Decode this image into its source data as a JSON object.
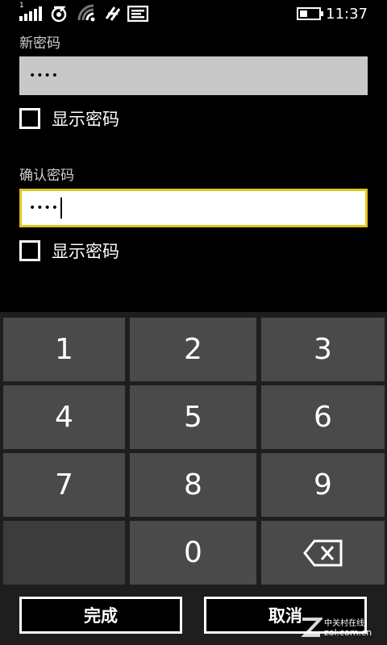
{
  "status_bar": {
    "time": "11:37",
    "sim_index": "1",
    "icons": [
      "signal-icon",
      "data-sync-icon",
      "wifi-icon",
      "bluetooth-icon",
      "message-icon",
      "battery-icon"
    ]
  },
  "form": {
    "new_password": {
      "label": "新密码",
      "masked_value": "••••",
      "show_password_label": "显示密码"
    },
    "confirm_password": {
      "label": "确认密码",
      "masked_value": "••••",
      "show_password_label": "显示密码"
    }
  },
  "keypad": {
    "keys": [
      "1",
      "2",
      "3",
      "4",
      "5",
      "6",
      "7",
      "8",
      "9",
      "",
      "0",
      "backspace"
    ]
  },
  "actions": {
    "done": "完成",
    "cancel": "取消"
  },
  "watermark": {
    "line1": "中关村在线",
    "line2": "zol.com.cn"
  },
  "colors": {
    "accent": "#e0c81e",
    "key_bg": "#4a4a4a",
    "keypad_bg": "#1e1e1e",
    "inactive_field": "#c8c8c8"
  }
}
